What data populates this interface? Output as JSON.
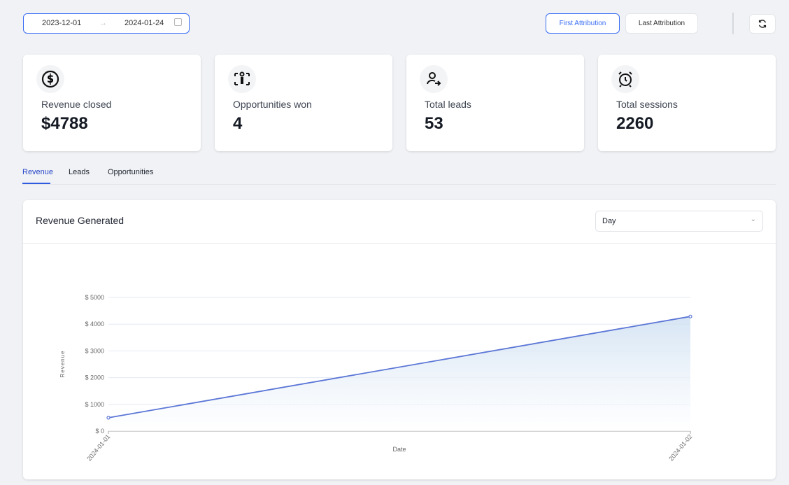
{
  "date_range": {
    "start": "2023-12-01",
    "end": "2024-01-24"
  },
  "attribution": {
    "first": "First Attribution",
    "last": "Last Attribution",
    "selected": "First Attribution"
  },
  "cards": [
    {
      "label": "Revenue closed",
      "value": "$4788",
      "icon": "dollar-circle-icon"
    },
    {
      "label": "Opportunities won",
      "value": "4",
      "icon": "person-arrows-icon"
    },
    {
      "label": "Total leads",
      "value": "53",
      "icon": "user-arrow-icon"
    },
    {
      "label": "Total sessions",
      "value": "2260",
      "icon": "alarm-clock-icon"
    }
  ],
  "tabs": [
    {
      "label": "Revenue",
      "active": true
    },
    {
      "label": "Leads"
    },
    {
      "label": "Opportunities"
    }
  ],
  "chart_panel": {
    "title": "Revenue Generated",
    "granularity": "Day"
  },
  "colors": {
    "accent": "#3b6ef5",
    "line": "#5b76d6",
    "background": "#f0f2f5"
  },
  "chart_data": {
    "type": "area",
    "xlabel": "Date",
    "ylabel": "Revenue",
    "x": [
      "2024-01-01",
      "2024-01-02"
    ],
    "series": [
      {
        "values": [
          500,
          4288
        ]
      }
    ],
    "ylim": [
      0,
      5000
    ],
    "yticks": [
      0,
      1000,
      2000,
      3000,
      4000,
      5000
    ],
    "ytick_labels": [
      "$ 0",
      "$ 1000",
      "$ 2000",
      "$ 3000",
      "$ 4000",
      "$ 5000"
    ],
    "grid": true,
    "legend": "none"
  }
}
